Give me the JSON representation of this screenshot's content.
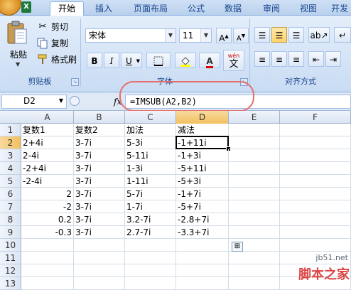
{
  "tabs": [
    "开始",
    "插入",
    "页面布局",
    "公式",
    "数据",
    "审阅",
    "视图",
    "开发"
  ],
  "active_tab": 0,
  "clipboard": {
    "paste_label": "粘贴",
    "cut_label": "剪切",
    "copy_label": "复制",
    "format_painter_label": "格式刷",
    "group_label": "剪贴板"
  },
  "font": {
    "font_name": "宋体",
    "font_size": "11",
    "bold": "B",
    "italic": "I",
    "underline": "U",
    "color_a": "A",
    "wen_label": "wén",
    "wen_char": "文",
    "group_label": "字体"
  },
  "alignment": {
    "group_label": "对齐方式"
  },
  "formula_bar": {
    "name_box": "D2",
    "fx_label": "fx",
    "formula": "=IMSUB(A2,B2)"
  },
  "grid": {
    "columns": [
      "A",
      "B",
      "C",
      "D",
      "E",
      "F"
    ],
    "rows": [
      [
        "复数1",
        "复数2",
        "加法",
        "减法"
      ],
      [
        "2+4i",
        "3-7i",
        "5-3i",
        "-1+11i"
      ],
      [
        "2-4i",
        "3-7i",
        "5-11i",
        "-1+3i"
      ],
      [
        "-2+4i",
        "3-7i",
        "1-3i",
        "-5+11i"
      ],
      [
        "-2-4i",
        "3-7i",
        "1-11i",
        "-5+3i"
      ],
      [
        "2",
        "3-7i",
        "5-7i",
        "-1+7i"
      ],
      [
        "-2",
        "3-7i",
        "1-7i",
        "-5+7i"
      ],
      [
        "0.2",
        "3-7i",
        "3.2-7i",
        "-2.8+7i"
      ],
      [
        "-0.3",
        "3-7i",
        "2.7-7i",
        "-3.3+7i"
      ],
      [
        "",
        "",
        "",
        ""
      ],
      [
        "",
        "",
        "",
        ""
      ],
      [
        "",
        "",
        "",
        ""
      ],
      [
        "",
        "",
        "",
        ""
      ]
    ],
    "numeric_cells": [
      "6-0",
      "7-0",
      "8-0",
      "9-0"
    ],
    "selected_cell": "D2"
  },
  "watermark": {
    "site": "jb51.net",
    "name": "脚本之家"
  },
  "colors": {
    "highlight": "#e76d6d",
    "ribbon": "#dbe7f7",
    "accent_text": "#15428b"
  }
}
